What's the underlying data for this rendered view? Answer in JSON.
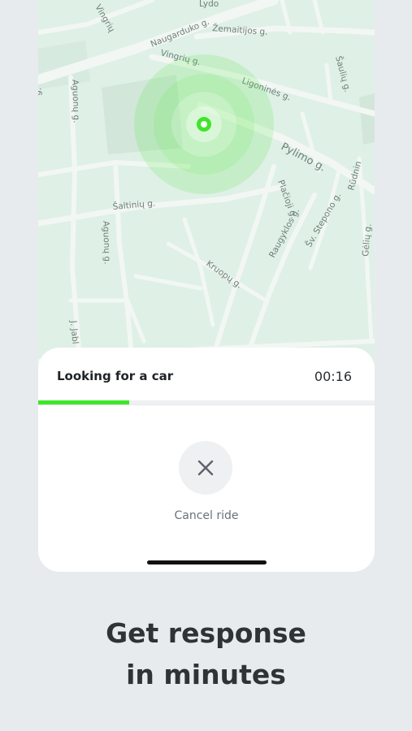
{
  "map": {
    "streets": [
      "Naugarduko g.",
      "Žemaitijos g.",
      "Vingrių g.",
      "Ligoninės g.",
      "Šaltinių g.",
      "Pylimo g.",
      "Plačioji g.",
      "Raugyklos g.",
      "Šv. Stepono g.",
      "Kruopų g.",
      "Aguonų g.",
      "Šaulių g.",
      "Rūdnin",
      "Gėlių g.",
      "J. Jabl",
      "Vingrių",
      "Lydo",
      "Aguonų g.",
      "g."
    ],
    "colors": {
      "land": "#dff0e6",
      "road": "#f2f7f4",
      "pulse": "#3ee629",
      "marker": "#3ee629"
    }
  },
  "sheet": {
    "title": "Looking for a car",
    "timer": "00:16",
    "progress_fraction": 0.27,
    "cancel_label": "Cancel ride",
    "cancel_icon": "close-icon"
  },
  "headline": {
    "line1": "Get response",
    "line2": "in minutes"
  }
}
